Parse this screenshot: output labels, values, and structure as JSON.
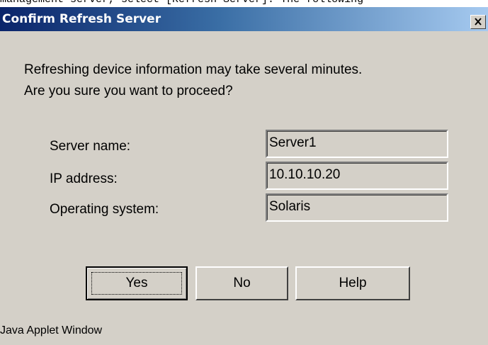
{
  "background": {
    "text": "management server, select [Refresh Server]. The following"
  },
  "dialog": {
    "title": "Confirm Refresh Server",
    "close_glyph": "×",
    "message_line1": "Refreshing device information may take several minutes.",
    "message_line2": "Are you sure you want to proceed?",
    "fields": [
      {
        "label": "Server name:",
        "value": "Server1"
      },
      {
        "label": "IP address:",
        "value": "10.10.10.20"
      },
      {
        "label": "Operating system:",
        "value": "Solaris"
      }
    ],
    "buttons": {
      "yes": "Yes",
      "no": "No",
      "help": "Help"
    },
    "footer": "Java Applet Window"
  },
  "colors": {
    "dialog_background": "#d4d0c8",
    "titlebar_start": "#0a246a",
    "titlebar_end": "#a6caf0",
    "title_text": "#ffffff"
  },
  "icons": {
    "close": "close-icon"
  }
}
